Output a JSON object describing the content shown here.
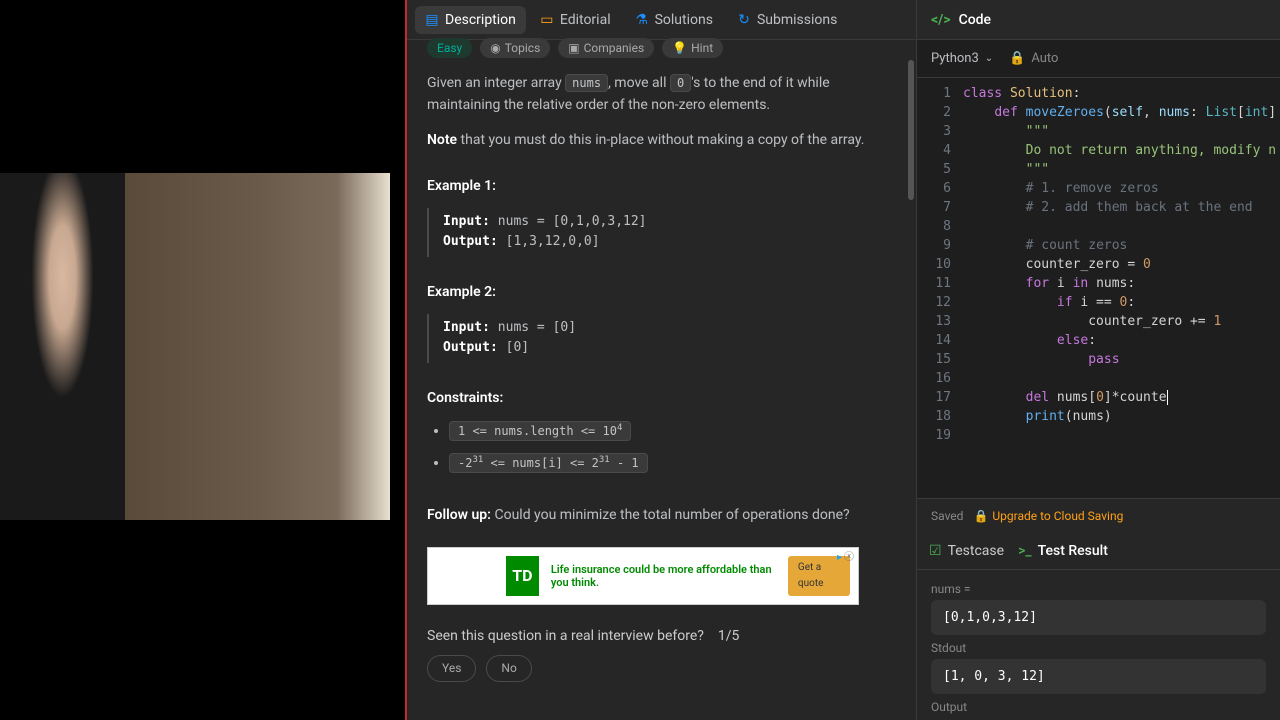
{
  "tabs": {
    "description": "Description",
    "editorial": "Editorial",
    "solutions": "Solutions",
    "submissions": "Submissions"
  },
  "tags": {
    "easy": "Easy",
    "topics": "Topics",
    "companies": "Companies",
    "hint": "Hint"
  },
  "problem": {
    "intro_1": "Given an integer array ",
    "intro_code": "nums",
    "intro_2": ", move all ",
    "intro_zero": "0",
    "intro_3": "'s to the end of it while maintaining the relative order of the non-zero elements.",
    "note_label": "Note",
    "note_text": " that you must do this in-place without making a copy of the array.",
    "example1_h": "Example 1:",
    "ex1_input_label": "Input:",
    "ex1_input_val": " nums = [0,1,0,3,12]",
    "ex1_output_label": "Output:",
    "ex1_output_val": " [1,3,12,0,0]",
    "example2_h": "Example 2:",
    "ex2_input_label": "Input:",
    "ex2_input_val": " nums = [0]",
    "ex2_output_label": "Output:",
    "ex2_output_val": " [0]",
    "constraints_h": "Constraints:",
    "constraint1": "1 <= nums.length <= 10⁴",
    "constraint2": "-2³¹ <= nums[i] <= 2³¹ - 1",
    "followup_label": "Follow up:",
    "followup_text": " Could you minimize the total number of operations done?",
    "interview_q": "Seen this question in a real interview before?",
    "interview_count": "1/5",
    "yes": "Yes",
    "no": "No"
  },
  "ad": {
    "logo": "TD",
    "text": "Life insurance could be more affordable than you think.",
    "cta": "Get a quote"
  },
  "code_header": {
    "title": "Code",
    "language": "Python3",
    "auto": "Auto"
  },
  "code": {
    "lines": [
      "class Solution:",
      "    def moveZeroes(self, nums: List[int])",
      "        \"\"\"",
      "        Do not return anything, modify n",
      "        \"\"\"",
      "        # 1. remove zeros",
      "        # 2. add them back at the end",
      "",
      "        # count zeros",
      "        counter_zero = 0",
      "        for i in nums:",
      "            if i == 0:",
      "                counter_zero += 1",
      "            else:",
      "                pass",
      "",
      "        del nums[0]*counte",
      "        print(nums)",
      ""
    ]
  },
  "saved": {
    "label": "Saved",
    "upgrade": "Upgrade to Cloud Saving"
  },
  "results": {
    "tab_testcase": "Testcase",
    "tab_result": "Test Result",
    "nums_label": "nums =",
    "nums_val": "[0,1,0,3,12]",
    "stdout_label": "Stdout",
    "stdout_val": "[1, 0, 3, 12]",
    "output_label": "Output"
  }
}
